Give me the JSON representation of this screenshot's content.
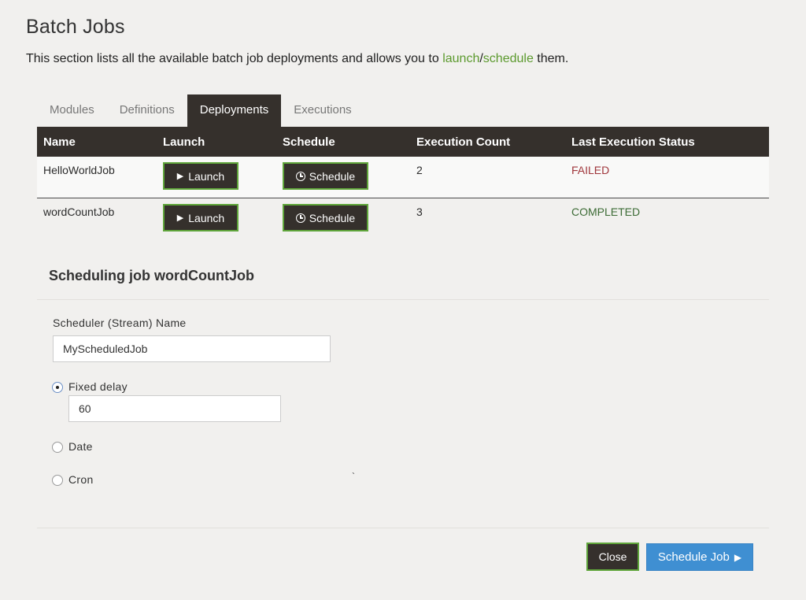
{
  "page": {
    "title": "Batch Jobs",
    "intro_before": "This section lists all the available batch job deployments and allows you to ",
    "intro_link1": "launch",
    "intro_sep": "/",
    "intro_link2": "schedule",
    "intro_after": " them."
  },
  "tabs": [
    {
      "label": "Modules"
    },
    {
      "label": "Definitions"
    },
    {
      "label": "Deployments"
    },
    {
      "label": "Executions"
    }
  ],
  "table": {
    "headers": [
      "Name",
      "Launch",
      "Schedule",
      "Execution Count",
      "Last Execution Status"
    ],
    "rows": [
      {
        "name": "HelloWorldJob",
        "launch": "Launch",
        "schedule": "Schedule",
        "count": "2",
        "status": "FAILED"
      },
      {
        "name": "wordCountJob",
        "launch": "Launch",
        "schedule": "Schedule",
        "count": "3",
        "status": "COMPLETED"
      }
    ]
  },
  "scheduler": {
    "title": "Scheduling job wordCountJob",
    "name_label": "Scheduler (Stream) Name",
    "name_value": "MyScheduledJob",
    "options": [
      {
        "label": "Fixed delay",
        "selected": true,
        "value": "60"
      },
      {
        "label": "Date",
        "selected": false
      },
      {
        "label": "Cron",
        "selected": false
      }
    ],
    "stray_mark": "`"
  },
  "footer": {
    "close_label": "Close",
    "schedule_label": "Schedule Job"
  },
  "colors": {
    "dark": "#35302c",
    "accent_green": "#5fa53a",
    "failed": "#a0373c",
    "completed": "#3c6b35",
    "primary_blue": "#3f8fd2"
  },
  "icons": [
    "play-icon",
    "clock-icon",
    "play-icon"
  ]
}
